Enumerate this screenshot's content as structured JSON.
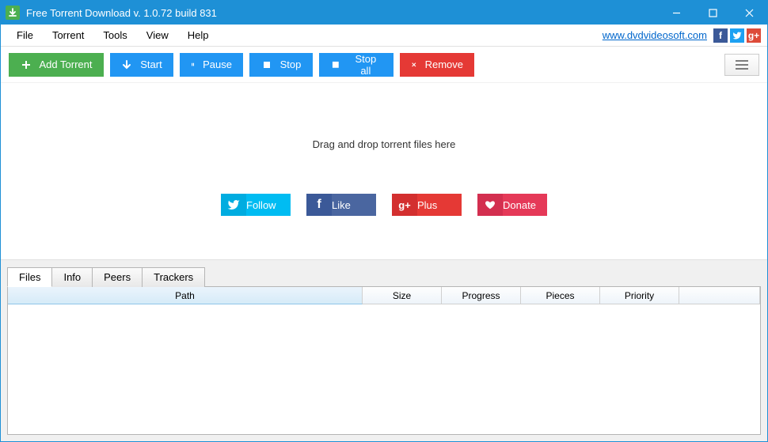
{
  "titlebar": {
    "title": "Free Torrent Download v. 1.0.72 build 831"
  },
  "menubar": {
    "items": [
      "File",
      "Torrent",
      "Tools",
      "View",
      "Help"
    ],
    "link": "www.dvdvideosoft.com"
  },
  "toolbar": {
    "add": "Add Torrent",
    "start": "Start",
    "pause": "Pause",
    "stop": "Stop",
    "stopall": "Stop all",
    "remove": "Remove"
  },
  "drop_text": "Drag and drop torrent files here",
  "social": {
    "follow": "Follow",
    "like": "Like",
    "plus": "Plus",
    "donate": "Donate"
  },
  "tabs": [
    "Files",
    "Info",
    "Peers",
    "Trackers"
  ],
  "columns": {
    "path": "Path",
    "size": "Size",
    "progress": "Progress",
    "pieces": "Pieces",
    "priority": "Priority"
  }
}
